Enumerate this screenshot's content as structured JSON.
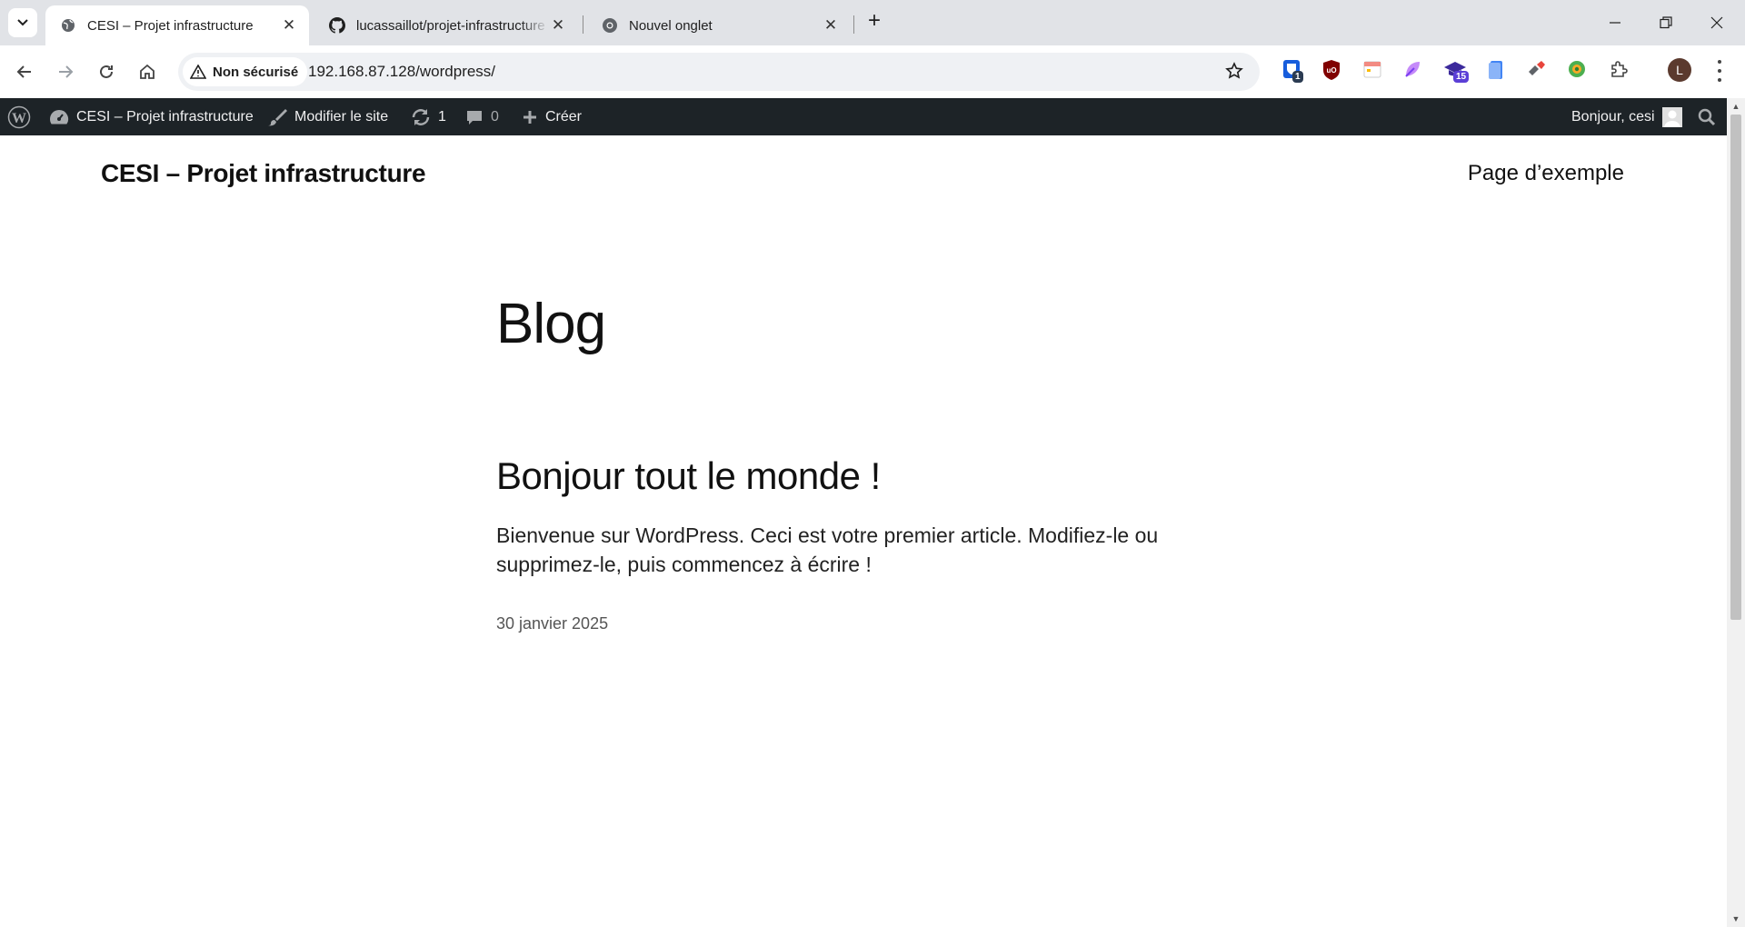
{
  "browser": {
    "tabs": [
      {
        "title": "CESI – Projet infrastructure",
        "active": true,
        "favicon": "globe-icon"
      },
      {
        "title": "lucassaillot/projet-infrastructure",
        "active": false,
        "favicon": "github-icon"
      },
      {
        "title": "Nouvel onglet",
        "active": false,
        "favicon": "chrome-icon"
      }
    ],
    "security_label": "Non sécurisé",
    "url": "192.168.87.128/wordpress/",
    "extension_badges": {
      "first": "1",
      "calendar": "15"
    },
    "profile_initial": "L"
  },
  "adminbar": {
    "site_name": "CESI – Projet infrastructure",
    "edit_site": "Modifier le site",
    "updates_count": "1",
    "comments_count": "0",
    "new_label": "Créer",
    "greeting": "Bonjour, cesi"
  },
  "site": {
    "title": "CESI – Projet infrastructure",
    "nav": [
      "Page d’exemple"
    ]
  },
  "main": {
    "heading": "Blog",
    "posts": [
      {
        "title": "Bonjour tout le monde !",
        "excerpt": "Bienvenue sur WordPress. Ceci est votre premier article. Modifiez-le ou supprimez-le, puis commencez à écrire !",
        "date": "30 janvier 2025"
      }
    ]
  },
  "colors": {
    "adminbar_bg": "#1d2327",
    "tabstrip_bg": "#e1e3e7",
    "omnibox_bg": "#eff1f4"
  }
}
